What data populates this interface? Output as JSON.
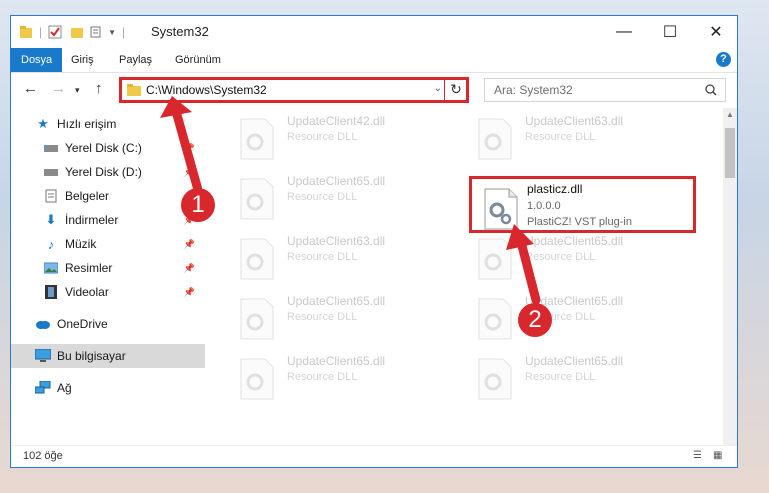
{
  "window": {
    "title": "System32",
    "close_glyph": "✕",
    "maximize_glyph": "☐",
    "minimize_glyph": "—"
  },
  "ribbon": {
    "tabs": [
      "Dosya",
      "Giriş",
      "Paylaş",
      "Görünüm"
    ],
    "help": "?"
  },
  "navigation": {
    "address": "C:\\Windows\\System32",
    "search_placeholder": "Ara: System32"
  },
  "sidebar": {
    "items": [
      {
        "label": "Hızlı erişim",
        "icon": "star-icon"
      },
      {
        "label": "Yerel Disk (C:)",
        "icon": "drive-icon",
        "pinned": true
      },
      {
        "label": "Yerel Disk (D:)",
        "icon": "drive-icon",
        "pinned": true
      },
      {
        "label": "Belgeler",
        "icon": "document-icon",
        "pinned": true
      },
      {
        "label": "İndirmeler",
        "icon": "download-icon",
        "pinned": true
      },
      {
        "label": "Müzik",
        "icon": "music-icon",
        "pinned": true
      },
      {
        "label": "Resimler",
        "icon": "pictures-icon",
        "pinned": true
      },
      {
        "label": "Videolar",
        "icon": "video-icon",
        "pinned": true
      },
      {
        "label": "OneDrive",
        "icon": "cloud-icon"
      },
      {
        "label": "Bu bilgisayar",
        "icon": "computer-icon",
        "selected": true
      },
      {
        "label": "Ağ",
        "icon": "network-icon"
      }
    ]
  },
  "files": [
    {
      "name": "UpdateClient42.dll",
      "desc": "Resource DLL"
    },
    {
      "name": "UpdateClient63.dll",
      "desc": "Resource DLL"
    },
    {
      "name": "UpdateClient65.dll",
      "desc": "Resource DLL"
    },
    {
      "name": "plasticz.dll",
      "version": "1.0.0.0",
      "desc": "PlastiCZ! VST plug-in",
      "highlighted": true
    },
    {
      "name": "UpdateClient63.dll",
      "desc": "Resource DLL"
    },
    {
      "name": "UpdateClient65.dll",
      "desc": "Resource DLL"
    },
    {
      "name": "UpdateClient65.dll",
      "desc": "Resource DLL"
    },
    {
      "name": "UpdateClient65.dll",
      "desc": "Resource DLL"
    },
    {
      "name": "UpdateClient65.dll",
      "desc": "Resource DLL"
    },
    {
      "name": "UpdateClient65.dll",
      "desc": "Resource DLL"
    }
  ],
  "status": {
    "count": "102 öğe"
  },
  "annotations": {
    "label1": "1",
    "label2": "2",
    "color": "#d9272e"
  }
}
